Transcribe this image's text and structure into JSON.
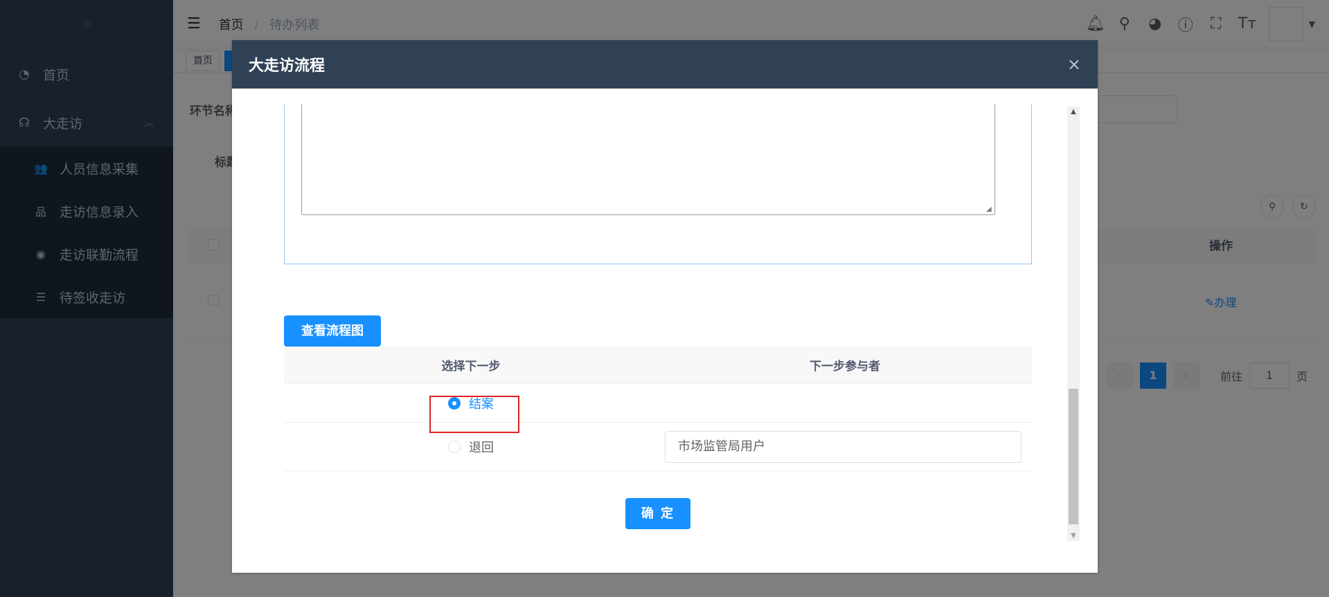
{
  "sidebar": {
    "logo_icon": "lotus-logo",
    "items": [
      {
        "icon": "dashboard-icon",
        "label": "首页"
      },
      {
        "icon": "visit-icon",
        "label": "大走访",
        "expanded": true
      }
    ],
    "subitems": [
      {
        "icon": "user-group-icon",
        "label": "人员信息采集"
      },
      {
        "icon": "tree-icon",
        "label": "走访信息录入"
      },
      {
        "icon": "eye-icon",
        "label": "走访联勤流程"
      },
      {
        "icon": "list-icon",
        "label": "待签收走访"
      }
    ]
  },
  "navbar": {
    "breadcrumb_home": "首页",
    "breadcrumb_sep": "/",
    "breadcrumb_current": "待办列表",
    "icons": [
      "bell-icon",
      "search-icon",
      "github-icon",
      "question-icon",
      "fullscreen-icon",
      "font-size-icon"
    ]
  },
  "tags": {
    "home": "首页"
  },
  "background": {
    "filter_label": "环节名称",
    "title_label": "标题",
    "op_header": "操作",
    "op_link": "办理",
    "pager": {
      "current_page": "1",
      "goto_label": "前往",
      "goto_value": "1",
      "page_unit": "页"
    }
  },
  "dialog": {
    "title": "大走访流程",
    "close_glyph": "×",
    "flow_button": "查看流程图",
    "table_header_step": "选择下一步",
    "table_header_participant": "下一步参与者",
    "options": [
      {
        "label": "结案",
        "checked": true
      },
      {
        "label": "退回",
        "checked": false,
        "participant": "市场监管局用户"
      }
    ],
    "confirm_button": "确 定"
  },
  "colors": {
    "sidebar_bg": "#304156",
    "primary": "#1890ff",
    "highlight": "#e02020"
  }
}
